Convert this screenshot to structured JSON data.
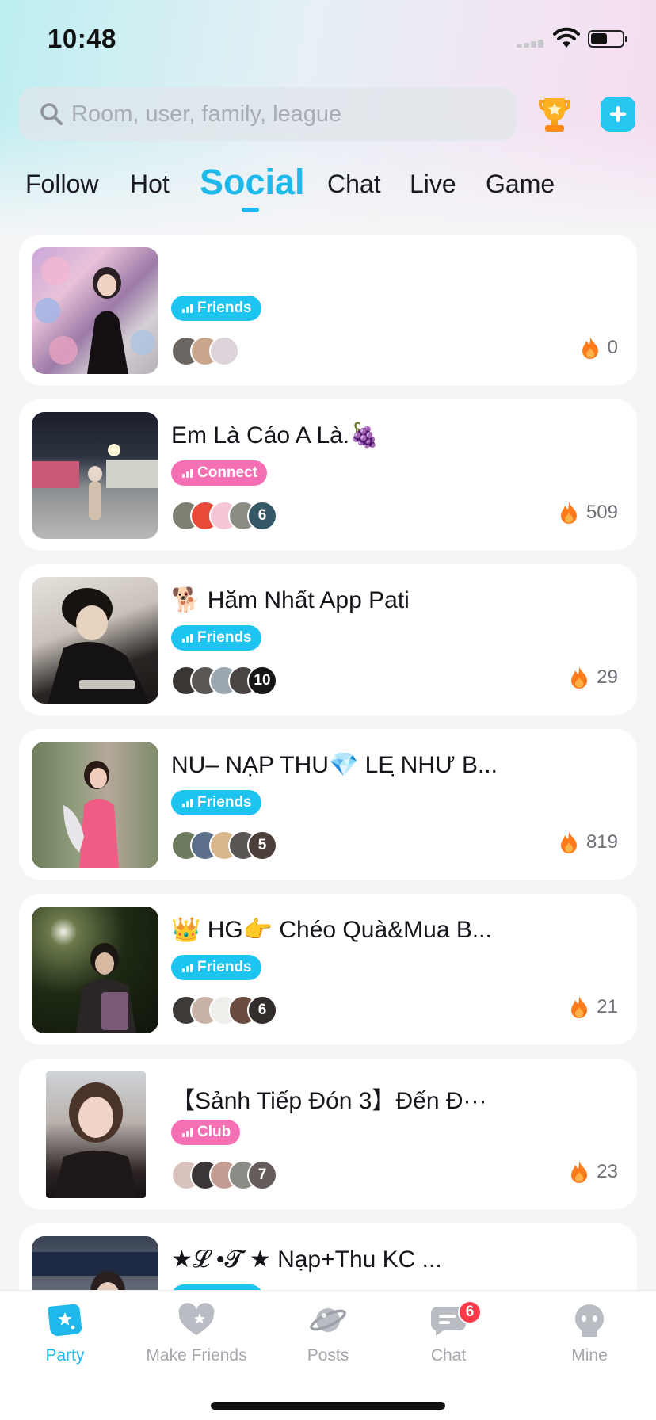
{
  "status_bar": {
    "time": "10:48"
  },
  "search": {
    "placeholder": "Room, user, family, league"
  },
  "tabs": [
    {
      "label": "Follow",
      "active": false
    },
    {
      "label": "Hot",
      "active": false
    },
    {
      "label": "Social",
      "active": true
    },
    {
      "label": "Chat",
      "active": false
    },
    {
      "label": "Live",
      "active": false
    },
    {
      "label": "Game",
      "active": false
    }
  ],
  "rooms": [
    {
      "title": "",
      "tag": "Friends",
      "tag_color": "#1ec4f0",
      "member_count_label": "",
      "heat": "0"
    },
    {
      "title": "Em Là Cáo A Là.🍇",
      "tag": "Connect",
      "tag_color": "#f56fb4",
      "member_count_label": "6",
      "heat": "509"
    },
    {
      "title": "🐕 Hăm Nhất App Pati",
      "tag": "Friends",
      "tag_color": "#1ec4f0",
      "member_count_label": "10",
      "heat": "29"
    },
    {
      "title": "NU– NẠP THU💎 LE ̣NHƯ B...",
      "tag": "Friends",
      "tag_color": "#1ec4f0",
      "member_count_label": "5",
      "heat": "819"
    },
    {
      "title": "👑 HG👉 Chéo Quà&Mua B...",
      "tag": "Friends",
      "tag_color": "#1ec4f0",
      "member_count_label": "6",
      "heat": "21"
    },
    {
      "title": "【Sảnh Tiếp Đón 3】Đến Đ···",
      "tag": "Club",
      "tag_color": "#f56fb4",
      "member_count_label": "7",
      "heat": "23"
    },
    {
      "title": "★𝓛 •𝓣 ★ Nạp+Thu KC ...",
      "tag": "",
      "tag_color": "#1ec4f0",
      "member_count_label": "",
      "heat": ""
    }
  ],
  "bottom_nav": [
    {
      "label": "Party",
      "icon": "party-icon",
      "active": true
    },
    {
      "label": "Make Friends",
      "icon": "heart-icon",
      "active": false
    },
    {
      "label": "Posts",
      "icon": "planet-icon",
      "active": false
    },
    {
      "label": "Chat",
      "icon": "chat-bubble-icon",
      "active": false,
      "badge": "6"
    },
    {
      "label": "Mine",
      "icon": "profile-icon",
      "active": false
    }
  ],
  "colors": {
    "accent": "#1eb9ea",
    "friends_tag": "#1ec4f0",
    "connect_tag": "#f56fb4",
    "badge": "#ff3b4a",
    "fire": "#ff7a1a"
  }
}
